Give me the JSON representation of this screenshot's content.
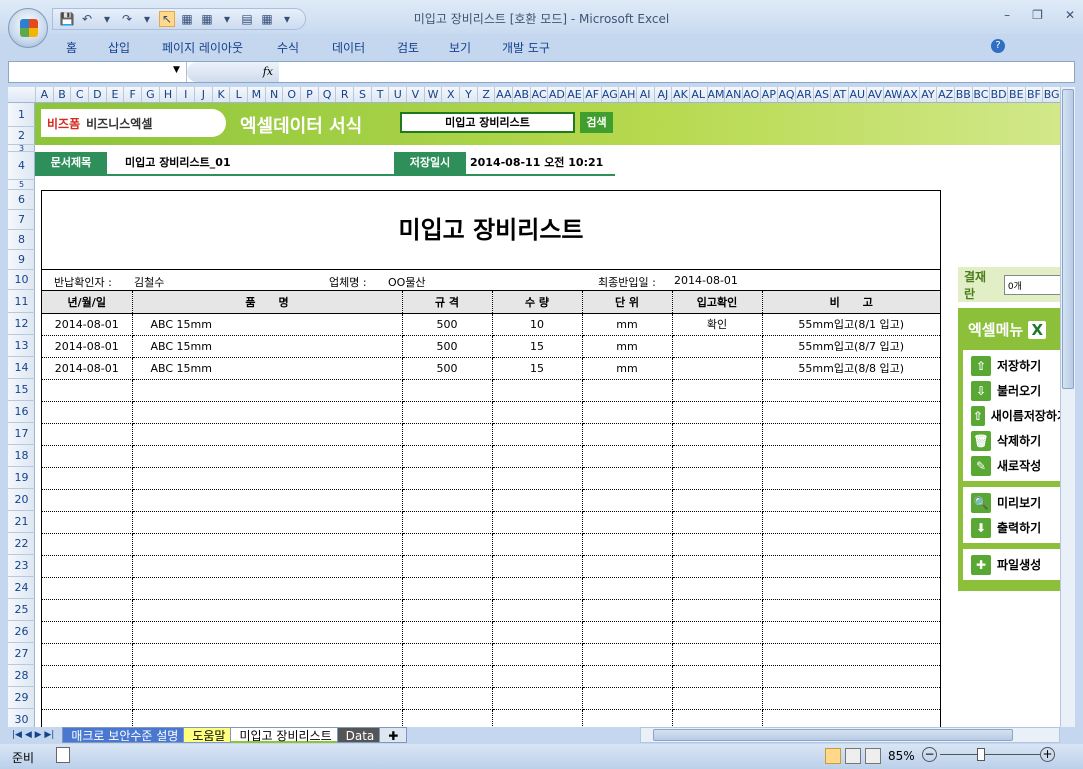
{
  "window": {
    "title": "미입고 장비리스트  [호환 모드] - Microsoft Excel",
    "controls": [
      "–",
      "❐",
      "✕"
    ]
  },
  "qat": [
    "💾",
    "↶",
    "▾",
    "↷",
    "▾",
    "↖",
    "▦",
    "▦",
    "▾",
    "▤",
    "▦",
    "▾"
  ],
  "ribbon": {
    "tabs": [
      "홈",
      "삽입",
      "페이지 레이아웃",
      "수식",
      "데이터",
      "검토",
      "보기",
      "개발 도구"
    ],
    "help": "?"
  },
  "formula": {
    "fx": "fx",
    "namebox": ""
  },
  "columns": [
    "A",
    "B",
    "C",
    "D",
    "E",
    "F",
    "G",
    "H",
    "I",
    "J",
    "K",
    "L",
    "M",
    "N",
    "O",
    "P",
    "Q",
    "R",
    "S",
    "T",
    "U",
    "V",
    "W",
    "X",
    "Y",
    "Z",
    "AA",
    "AB",
    "AC",
    "AD",
    "AE",
    "AF",
    "AG",
    "AH",
    "AI",
    "AJ",
    "AK",
    "AL",
    "AM",
    "AN",
    "AO",
    "AP",
    "AQ",
    "AR",
    "AS",
    "AT",
    "AU",
    "AV",
    "AW",
    "AX",
    "AY",
    "AZ",
    "BB",
    "BC",
    "BD",
    "BE",
    "BF",
    "BG"
  ],
  "banner": {
    "logo1": "비즈폼",
    "logo2": "비즈니스엑셀",
    "title": "엑셀데이터 서식",
    "search_value": "미입고 장비리스트",
    "search_button": "검색"
  },
  "docinfo": {
    "title_label": "문서제목",
    "title_value": "미입고 장비리스트_01",
    "saved_label": "저장일시",
    "saved_value": "2014-08-11  오전 10:21"
  },
  "sheet": {
    "title": "미입고 장비리스트",
    "returner_label": "반납확인자 :",
    "returner": "김철수",
    "company_label": "업체명 :",
    "company": "OO물산",
    "last_date_label": "최종반입일 :",
    "last_date": "2014-08-01",
    "headers": [
      "년/월/일",
      "품      명",
      "규 격",
      "수 량",
      "단 위",
      "입고확인",
      "비      고"
    ],
    "rows": [
      [
        "2014-08-01",
        "ABC 15mm",
        "500",
        "10",
        "mm",
        "확인",
        "55mm입고(8/1 입고)"
      ],
      [
        "2014-08-01",
        "ABC 15mm",
        "500",
        "15",
        "mm",
        "",
        "55mm입고(8/7 입고)"
      ],
      [
        "2014-08-01",
        "ABC 15mm",
        "500",
        "15",
        "mm",
        "",
        "55mm입고(8/8 입고)"
      ]
    ],
    "empty_rows": 16
  },
  "side": {
    "approval_label": "결재란",
    "approval_value": "0개",
    "menu_title": "엑셀메뉴",
    "groups": [
      [
        "저장하기",
        "불러오기",
        "새이름저장하기",
        "삭제하기",
        "새로작성"
      ],
      [
        "미리보기",
        "출력하기"
      ],
      [
        "파일생성"
      ]
    ]
  },
  "tabs": [
    "매크로 보안수준 설명",
    "도움말",
    "미입고 장비리스트",
    "Data"
  ],
  "status": {
    "ready": "준비",
    "zoom": "85%"
  }
}
